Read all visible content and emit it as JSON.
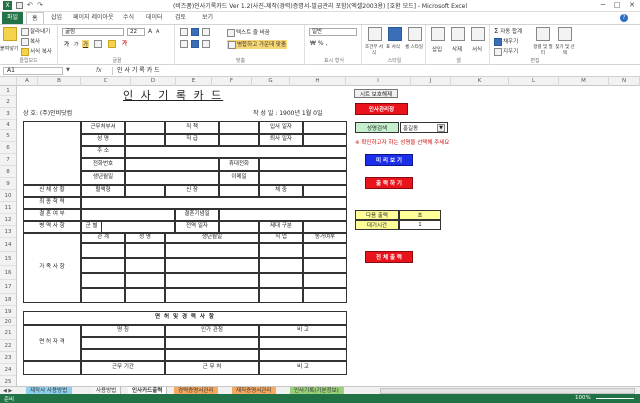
{
  "window": {
    "title": "(비즈폼)인사기록카드 Ver 1.2(사진-제작(경력)증명서-발급관리 포함)(엑셀2003용) [호환 모드] - Microsoft Excel",
    "min": "─",
    "max": "□",
    "close": "✕"
  },
  "ribbon_tabs": [
    "파일",
    "홈",
    "삽입",
    "페이지 레이아웃",
    "수식",
    "데이터",
    "검토",
    "보기"
  ],
  "ribbon": {
    "paste": "붙여넣기",
    "cut": "잘라내기",
    "copy": "복사",
    "format_painter": "서식 복사",
    "clipboard_group": "클립보드",
    "font_name": "굴림",
    "font_size": "22",
    "bold": "가",
    "italic": "가",
    "underline": "가",
    "font_group": "글꼴",
    "wrap_text": "텍스트 줄 바꿈",
    "merge_center": "병합하고 가운데 맞춤",
    "align_group": "맞춤",
    "number_format": "일반",
    "number_group": "표시 형식",
    "conditional": "조건부 서식",
    "table_format": "표 서식",
    "cell_style": "셀 스타일",
    "style_group": "스타일",
    "insert": "삽입",
    "delete": "삭제",
    "format": "서식",
    "cells_group": "셀",
    "autosum": "자동 합계",
    "fill": "채우기",
    "clear": "지우기",
    "sort_filter": "정렬 및 필터",
    "find_select": "찾기 및 선택",
    "edit_group": "편집"
  },
  "formula_bar": {
    "name_box": "A1",
    "fx": "fx",
    "value": "인 사 기 록 카 드"
  },
  "columns": [
    "A",
    "B",
    "C",
    "D",
    "E",
    "F",
    "G",
    "H",
    "I",
    "J",
    "K",
    "L",
    "M",
    "N"
  ],
  "rows": [
    "1",
    "2",
    "3",
    "4",
    "5",
    "6",
    "7",
    "8",
    "9",
    "10",
    "11",
    "12",
    "13",
    "14",
    "15",
    "16",
    "17",
    "18",
    "19",
    "20",
    "21",
    "22",
    "23",
    "24",
    "25"
  ],
  "form": {
    "title": "인 사 기 록 카 드",
    "company": "상 호: (주)인비닷컴",
    "created": "작 성 일 : 1900년 1월 0일",
    "labels": {
      "dept": "근무처부서",
      "position": "직 책",
      "hire_date": "입사 일자",
      "name": "성 명",
      "grade": "직 급",
      "leave_date": "퇴사 일자",
      "address": "주 소",
      "phone": "전화번호",
      "mobile": "휴대전화",
      "birth": "생년월일",
      "email": "이메일",
      "body": "신 체 상 황",
      "blood": "혈액형",
      "height": "신 장",
      "weight": "체 중",
      "education": "최 종 학 력",
      "marriage": "결 혼 여 부",
      "anniversary": "결혼기념일",
      "military": "병 역 사 항",
      "branch": "군 별",
      "discharge": "전역 일자",
      "discharge_type": "제대 구분",
      "family": "가 족 사 항",
      "relation": "관 계",
      "fam_name": "성 명",
      "fam_birth": "생년월일",
      "job": "직 업",
      "living": "동거여부",
      "license_header": "면 허 및 경 력 사 항",
      "license": "면 허 자 격",
      "lic_name": "명 칭",
      "lic_org": "인가 관청",
      "lic_note": "비 고",
      "work_period": "근무 기간",
      "work_place": "근 무 처",
      "work_note": "비 고"
    }
  },
  "controls": {
    "protect": "시트 보호해제",
    "hr_mgmt": "인사관리장",
    "lookup_label": "성명검색",
    "lookup_value": "홍길동",
    "hint": "※ 확인하고자 하는 성명을 선택해 주세요",
    "preview": "미 리 보 기",
    "print": "출 력 하 기",
    "next_print": "다음 출력",
    "wait_time": "대기시간",
    "sec": "초",
    "sec_value": "1",
    "print_all": "전 체 출 력"
  },
  "sheet_tabs": [
    "제작사 사용방법",
    "사용방법",
    "인사카드출력",
    "경력증명서관리",
    "재직증명서관리",
    "인사기록(기본정보)"
  ],
  "status": "준비",
  "zoom": "100%",
  "colors": {
    "excel_green": "#217346",
    "button_red": "#e8131b",
    "button_blue": "#1c2ee8",
    "lookup_green": "#c6efce",
    "hint_red": "#d01010",
    "panel_yellow": "#ffff99"
  }
}
